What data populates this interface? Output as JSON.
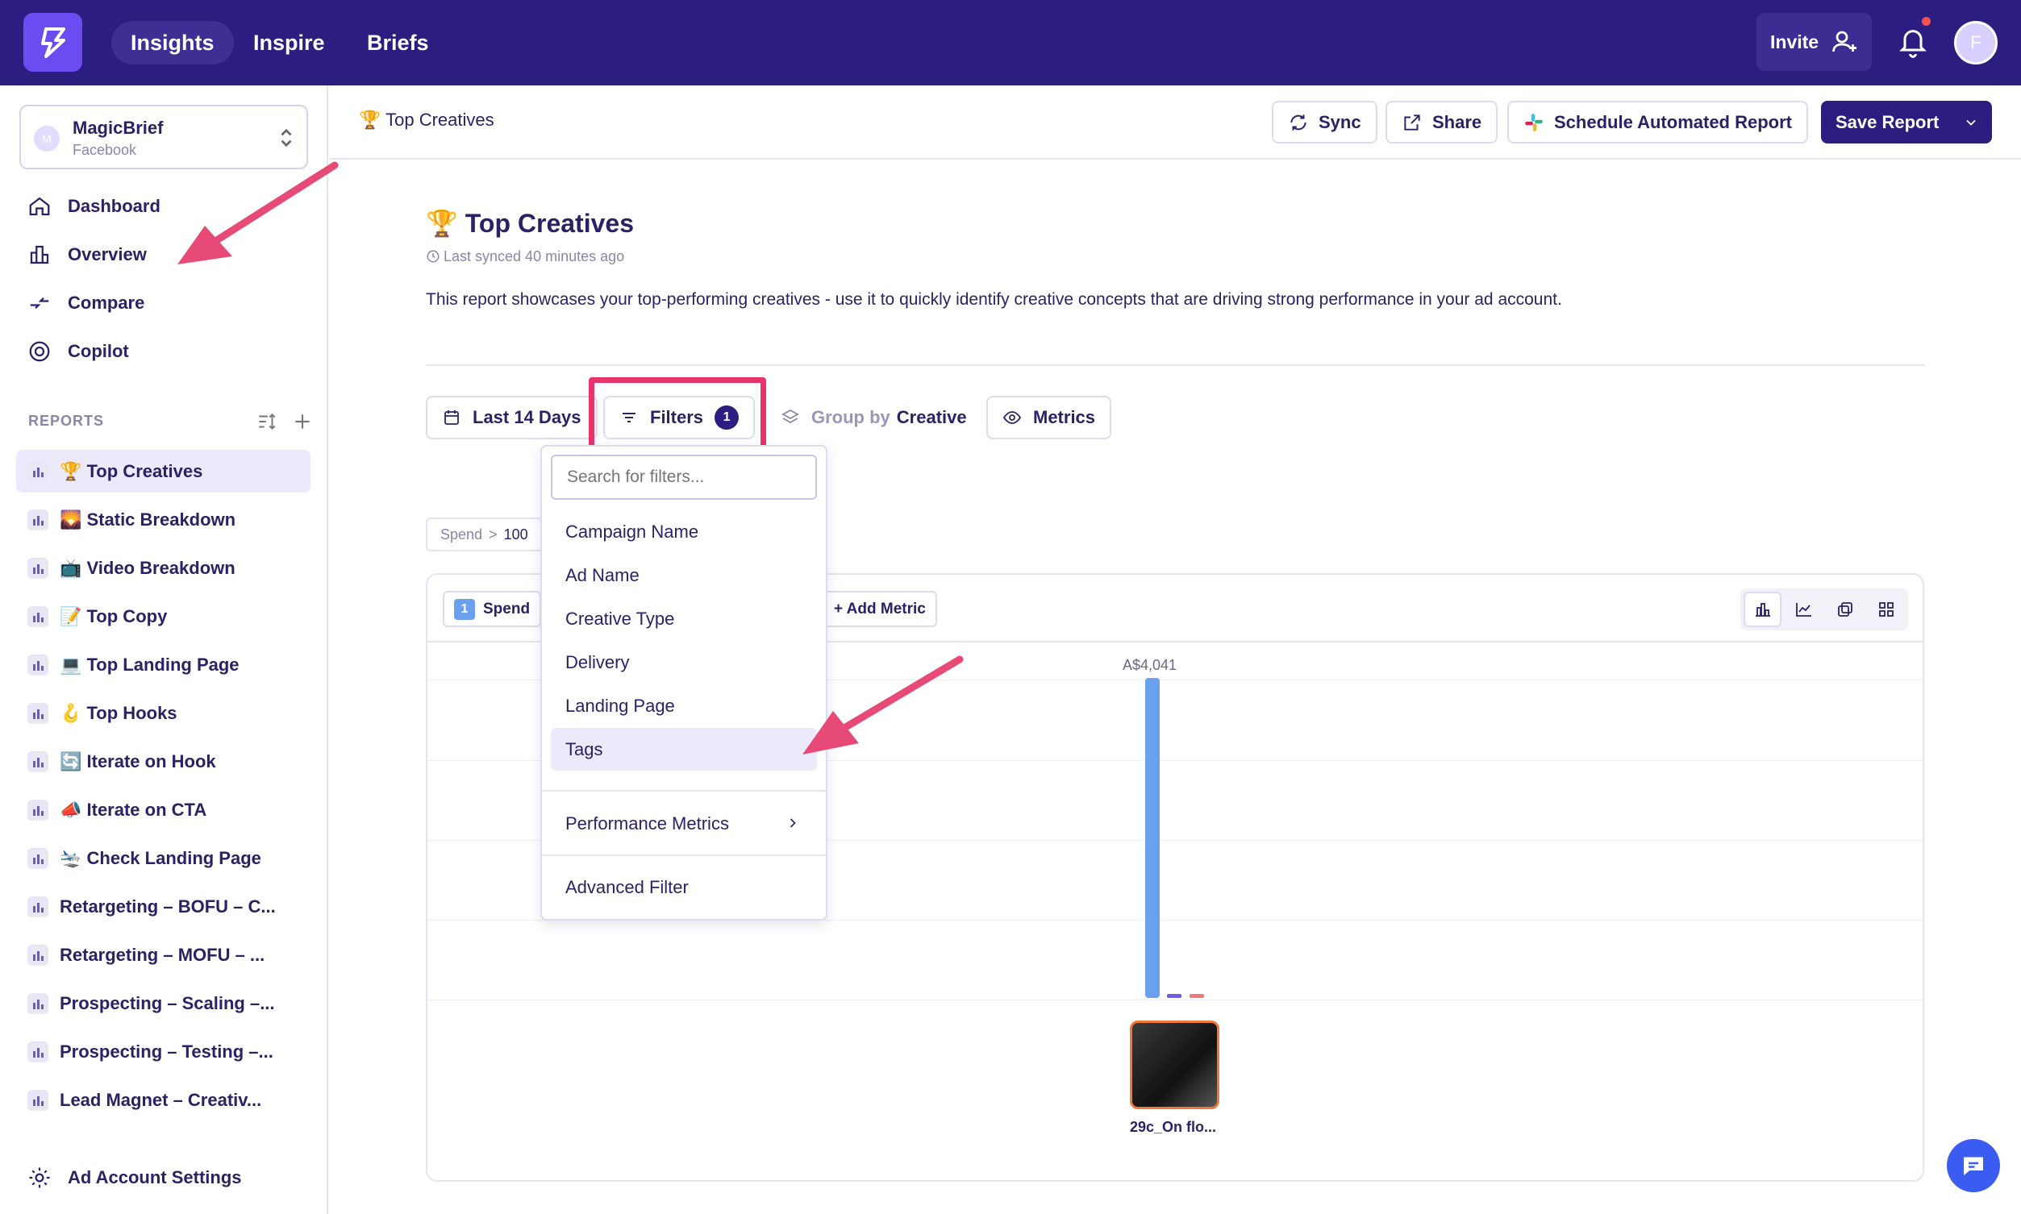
{
  "topnav": {
    "tabs": [
      {
        "label": "Insights"
      },
      {
        "label": "Inspire"
      },
      {
        "label": "Briefs"
      }
    ],
    "invite_label": "Invite",
    "avatar_initial": "F"
  },
  "sidebar": {
    "account_initial": "M",
    "account_name": "MagicBrief",
    "account_platform": "Facebook",
    "links": [
      {
        "label": "Dashboard"
      },
      {
        "label": "Overview"
      },
      {
        "label": "Compare"
      },
      {
        "label": "Copilot"
      }
    ],
    "reports_label": "REPORTS",
    "reports": [
      {
        "label": "🏆 Top Creatives"
      },
      {
        "label": "🌄 Static Breakdown"
      },
      {
        "label": "📺 Video Breakdown"
      },
      {
        "label": "📝 Top Copy"
      },
      {
        "label": "💻 Top Landing Page"
      },
      {
        "label": "🪝 Top Hooks"
      },
      {
        "label": "🔄 Iterate on Hook"
      },
      {
        "label": "📣 Iterate on CTA"
      },
      {
        "label": "🛬 Check Landing Page"
      },
      {
        "label": "Retargeting – BOFU – C..."
      },
      {
        "label": "Retargeting – MOFU – ..."
      },
      {
        "label": "Prospecting – Scaling –..."
      },
      {
        "label": "Prospecting – Testing –..."
      },
      {
        "label": "Lead Magnet – Creativ..."
      }
    ],
    "settings_label": "Ad Account Settings"
  },
  "header": {
    "breadcrumb": "🏆 Top Creatives",
    "sync_label": "Sync",
    "share_label": "Share",
    "schedule_label": "Schedule Automated Report",
    "save_label": "Save Report"
  },
  "report": {
    "title": "🏆 Top Creatives",
    "last_synced": "Last synced 40 minutes ago",
    "description": "This report showcases your top-performing creatives - use it to quickly identify creative concepts that are driving strong performance in your ad account."
  },
  "filters_bar": {
    "date_label": "Last 14 Days",
    "filters_label": "Filters",
    "filters_count": "1",
    "group_prefix": "Group by",
    "group_value": "Creative",
    "metrics_label": "Metrics"
  },
  "filter_chip": {
    "metric": "Spend",
    "op": ">",
    "value": "100"
  },
  "chart_toolbar": {
    "metric_index": "1",
    "metric_label": "Spend",
    "add_metric_label": "+ Add Metric"
  },
  "chart_data": {
    "type": "bar",
    "categories": [
      "29c_On flo..."
    ],
    "series": [
      {
        "values": [
          4041
        ]
      }
    ],
    "data_labels": [
      "A$4,041"
    ]
  },
  "dropdown": {
    "search_placeholder": "Search for filters...",
    "items": [
      {
        "label": "Campaign Name"
      },
      {
        "label": "Ad Name"
      },
      {
        "label": "Creative Type"
      },
      {
        "label": "Delivery"
      },
      {
        "label": "Landing Page"
      },
      {
        "label": "Tags"
      }
    ],
    "performance_label": "Performance Metrics",
    "advanced_label": "Advanced Filter"
  },
  "colors": {
    "brand": "#2c1d80",
    "accent": "#6b4cf0",
    "highlight": "#e8336b",
    "bar": "#6ba0ef"
  }
}
